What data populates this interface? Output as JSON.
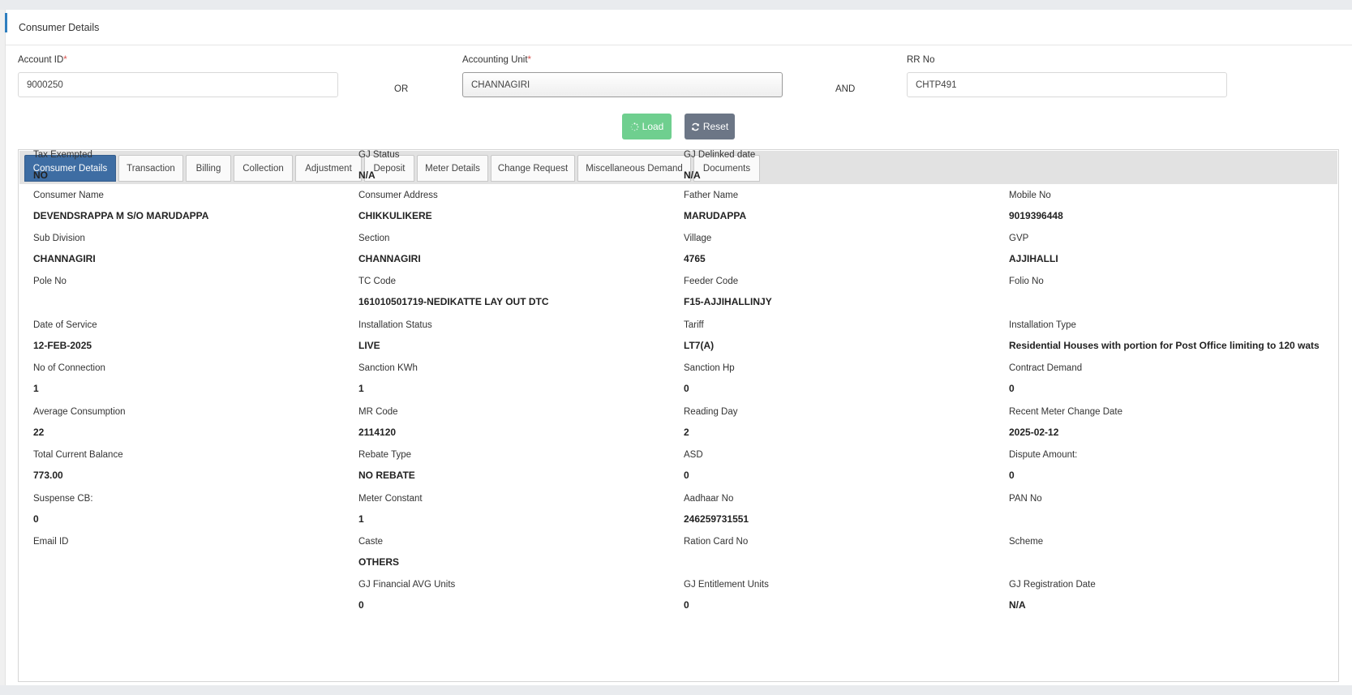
{
  "panel": {
    "title": "Consumer Details"
  },
  "form": {
    "account_id": {
      "label": "Account ID",
      "required": "*",
      "value": "9000250"
    },
    "or_label": "OR",
    "accounting_unit": {
      "label": "Accounting Unit",
      "required": "*",
      "value": "CHANNAGIRI"
    },
    "and_label": "AND",
    "rr_no": {
      "label": "RR No",
      "value": "CHTP491"
    }
  },
  "buttons": {
    "load": "Load",
    "reset": "Reset"
  },
  "tabs": [
    {
      "label": "Consumer Details"
    },
    {
      "label": "Transaction"
    },
    {
      "label": "Billing"
    },
    {
      "label": "Collection"
    },
    {
      "label": "Adjustment"
    },
    {
      "label": "Deposit"
    },
    {
      "label": "Meter Details"
    },
    {
      "label": "Change Request"
    },
    {
      "label": "Miscellaneous Demand"
    },
    {
      "label": "Documents"
    }
  ],
  "details": [
    {
      "label": "Consumer Name",
      "value": "DEVENDSRAPPA M S/O MARUDAPPA"
    },
    {
      "label": "Consumer Address",
      "value": "CHIKKULIKERE"
    },
    {
      "label": "Father Name",
      "value": "MARUDAPPA"
    },
    {
      "label": "Mobile No",
      "value": "9019396448"
    },
    {
      "label": "Sub Division",
      "value": "CHANNAGIRI"
    },
    {
      "label": "Section",
      "value": "CHANNAGIRI"
    },
    {
      "label": "Village",
      "value": "4765"
    },
    {
      "label": "GVP",
      "value": "AJJIHALLI"
    },
    {
      "label": "Pole No",
      "value": ""
    },
    {
      "label": "TC Code",
      "value": "161010501719-NEDIKATTE LAY OUT DTC"
    },
    {
      "label": "Feeder Code",
      "value": "F15-AJJIHALLINJY"
    },
    {
      "label": "Folio No",
      "value": ""
    },
    {
      "label": "Date of Service",
      "value": "12-FEB-2025"
    },
    {
      "label": "Installation Status",
      "value": "LIVE"
    },
    {
      "label": "Tariff",
      "value": "LT7(A)"
    },
    {
      "label": "Installation Type",
      "value": "Residential Houses with portion for Post Office limiting to 120 wats"
    },
    {
      "label": "No of Connection",
      "value": "1"
    },
    {
      "label": "Sanction KWh",
      "value": "1"
    },
    {
      "label": "Sanction Hp",
      "value": "0"
    },
    {
      "label": "Contract Demand",
      "value": "0"
    },
    {
      "label": "Average Consumption",
      "value": "22"
    },
    {
      "label": "MR Code",
      "value": "2114120"
    },
    {
      "label": "Reading Day",
      "value": "2"
    },
    {
      "label": "Recent Meter Change Date",
      "value": "2025-02-12"
    },
    {
      "label": "Total Current Balance",
      "value": "773.00"
    },
    {
      "label": "Rebate Type",
      "value": "NO REBATE"
    },
    {
      "label": "ASD",
      "value": "0"
    },
    {
      "label": "Dispute Amount:",
      "value": "0"
    },
    {
      "label": "Suspense CB:",
      "value": "0"
    },
    {
      "label": "Meter Constant",
      "value": "1"
    },
    {
      "label": "Aadhaar No",
      "value": "246259731551"
    },
    {
      "label": "PAN No",
      "value": ""
    },
    {
      "label": "Email ID",
      "value": ""
    },
    {
      "label": "Caste",
      "value": "OTHERS"
    },
    {
      "label": "Ration Card No",
      "value": ""
    },
    {
      "label": "Scheme",
      "value": ""
    },
    {
      "label": "",
      "value": ""
    },
    {
      "label": "GJ Financial AVG Units",
      "value": "0"
    },
    {
      "label": "GJ Entitlement Units",
      "value": "0"
    },
    {
      "label": "GJ Registration Date",
      "value": "N/A"
    },
    {
      "label": "Tax Exempted",
      "value": "NO"
    },
    {
      "label": "GJ Status",
      "value": "N/A"
    },
    {
      "label": "GJ Delinked date",
      "value": "N/A"
    },
    {
      "label": "",
      "value": ""
    }
  ],
  "icons": {
    "load": "spinner-icon",
    "reset": "refresh-icon"
  },
  "colors": {
    "accent": "#2f7fbf",
    "active_tab": "#3e6da3",
    "load_button": "#6fcf8f",
    "reset_button": "#6c7686",
    "required": "#d9534f"
  }
}
